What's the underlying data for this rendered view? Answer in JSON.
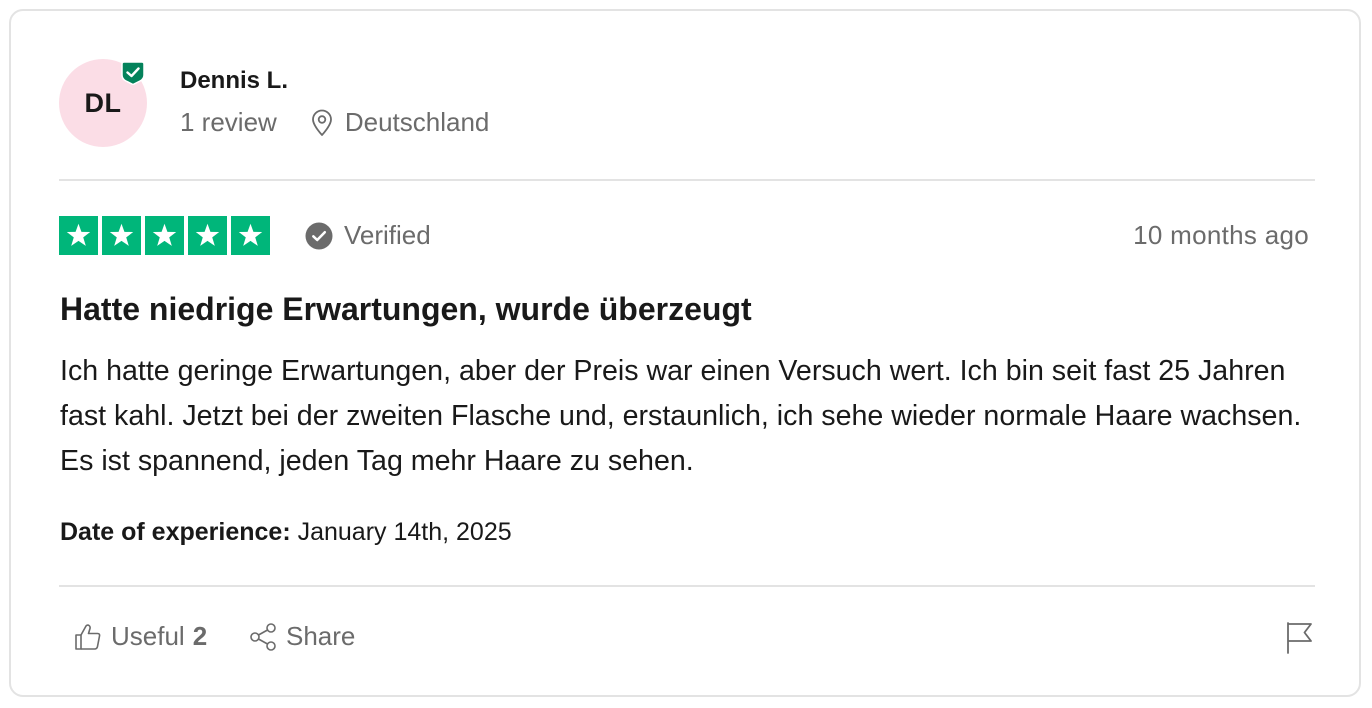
{
  "reviewer": {
    "initials": "DL",
    "name": "Dennis L.",
    "review_count": "1 review",
    "location": "Deutschland",
    "avatar_color": "#fbdde6",
    "badge_color": "#04825b"
  },
  "review": {
    "rating": 5,
    "rating_max": 5,
    "star_color": "#00b67a",
    "verified_label": "Verified",
    "date_posted": "10 months ago",
    "title": "Hatte niedrige Erwartungen, wurde überzeugt",
    "body": "Ich hatte geringe Erwartungen, aber der Preis war einen Versuch wert. Ich bin seit fast 25 Jahren fast kahl. Jetzt bei der zweiten Flasche und, erstaunlich, ich sehe wieder normale Haare wachsen. Es ist spannend, jeden Tag mehr Haare zu sehen.",
    "experience_label": "Date of experience:",
    "experience_date": "January 14th, 2025"
  },
  "actions": {
    "useful_label": "Useful",
    "useful_count": "2",
    "share_label": "Share"
  },
  "icons": {
    "verified_badge": "shield-check-icon",
    "location": "map-pin-icon",
    "verified": "check-circle-icon",
    "useful": "thumbs-up-icon",
    "share": "share-icon",
    "report": "flag-icon"
  }
}
